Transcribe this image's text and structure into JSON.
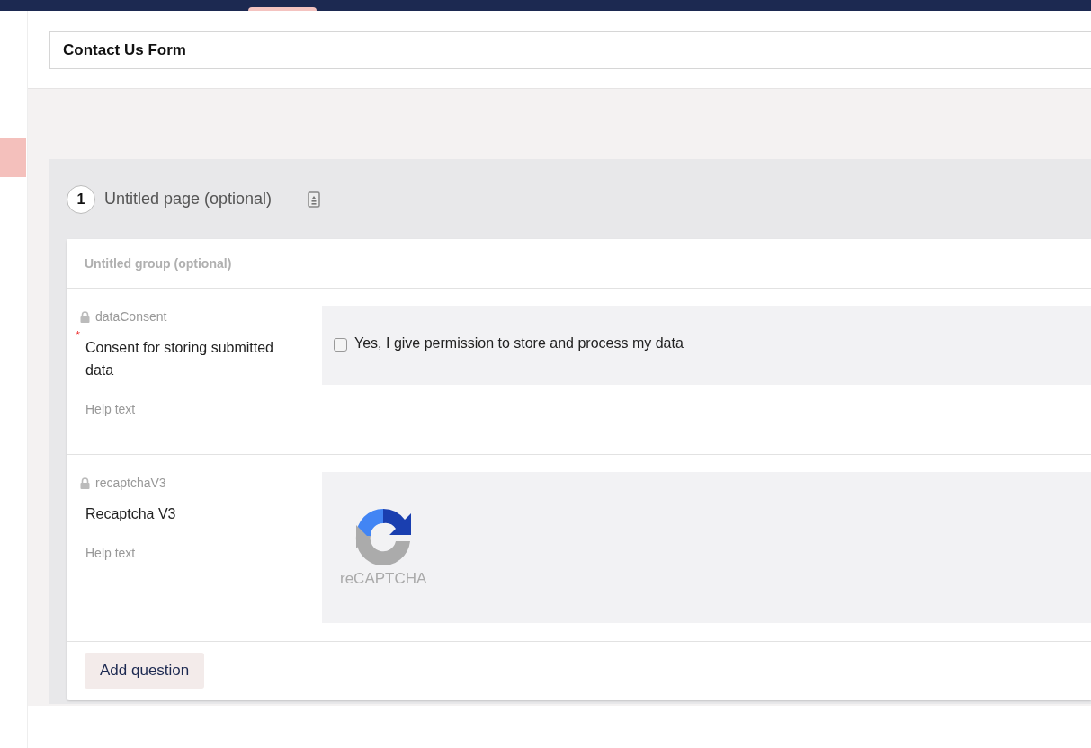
{
  "form_title": {
    "value": "Contact Us Form"
  },
  "page": {
    "number": "1",
    "title": "Untitled page (optional)"
  },
  "group": {
    "placeholder": "Untitled group (optional)"
  },
  "questions": [
    {
      "kind": "checkbox",
      "key": "dataConsent",
      "locked": true,
      "required": true,
      "label": "Consent for storing submitted data",
      "help": "Help text",
      "option": "Yes, I give permission to store and process my data",
      "checked": false
    },
    {
      "kind": "recaptcha",
      "key": "recaptchaV3",
      "locked": true,
      "required": false,
      "label": "Recaptcha V3",
      "help": "Help text",
      "logo_text": "reCAPTCHA"
    }
  ],
  "required_mark": "*",
  "add_button": "Add question"
}
